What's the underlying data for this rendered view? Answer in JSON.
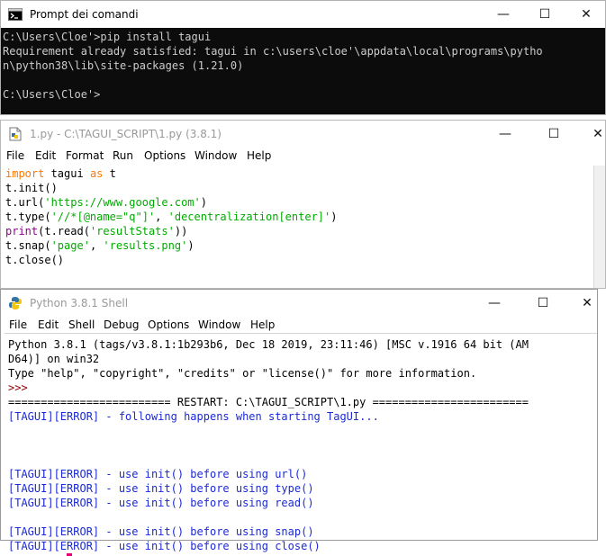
{
  "cmd": {
    "title": "Prompt dei comandi",
    "lines": [
      "C:\\Users\\Cloe'>pip install tagui",
      "Requirement already satisfied: tagui in c:\\users\\cloe'\\appdata\\local\\programs\\pytho",
      "n\\python38\\lib\\site-packages (1.21.0)",
      "",
      "C:\\Users\\Cloe'>"
    ]
  },
  "editor": {
    "title": "1.py - C:\\TAGUI_SCRIPT\\1.py (3.8.1)",
    "menu": [
      "File",
      "Edit",
      "Format",
      "Run",
      "Options",
      "Window",
      "Help"
    ],
    "code": {
      "l1_kw1": "import",
      "l1_mod": " tagui ",
      "l1_kw2": "as",
      "l1_alias": " t",
      "l2": "t.init()",
      "l3_a": "t.url(",
      "l3_s": "'https://www.google.com'",
      "l3_b": ")",
      "l4_a": "t.type(",
      "l4_s1": "'//*[@name=\"q\"]'",
      "l4_b": ", ",
      "l4_s2": "'decentralization[enter]'",
      "l4_c": ")",
      "l5_fn": "print",
      "l5_a": "(t.read(",
      "l5_s": "'resultStats'",
      "l5_b": "))",
      "l6_a": "t.snap(",
      "l6_s1": "'page'",
      "l6_b": ", ",
      "l6_s2": "'results.png'",
      "l6_c": ")",
      "l7": "t.close()"
    }
  },
  "shell": {
    "title": "Python 3.8.1 Shell",
    "menu": [
      "File",
      "Edit",
      "Shell",
      "Debug",
      "Options",
      "Window",
      "Help"
    ],
    "header": [
      "Python 3.8.1 (tags/v3.8.1:1b293b6, Dec 18 2019, 23:11:46) [MSC v.1916 64 bit (AM",
      "D64)] on win32",
      "Type \"help\", \"copyright\", \"credits\" or \"license()\" for more information."
    ],
    "prompt": ">>>",
    "restart": "========================= RESTART: C:\\TAGUI_SCRIPT\\1.py ========================",
    "errors": {
      "e1": "[TAGUI][ERROR] - following happens when starting TagUI...",
      "e2": "[TAGUI][ERROR] - use init() before using url()",
      "e3": "[TAGUI][ERROR] - use init() before using type()",
      "e4": "[TAGUI][ERROR] - use init() before using read()",
      "e5": "[TAGUI][ERROR] - use init() before using snap()",
      "e6": "[TAGUI][ERROR] - use init() before using close()"
    }
  },
  "controls": {
    "minimize": "—",
    "maximize": "☐",
    "close": "✕"
  }
}
